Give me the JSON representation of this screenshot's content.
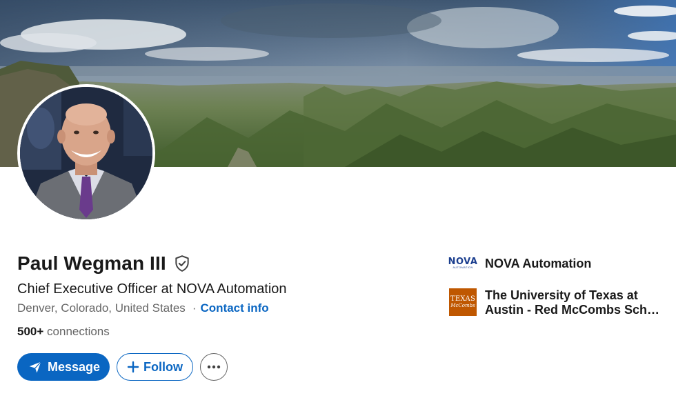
{
  "profile": {
    "name": "Paul Wegman III",
    "headline": "Chief Executive Officer at NOVA Automation",
    "location": "Denver, Colorado, United States",
    "separator": "·",
    "contact_info": "Contact info",
    "connections_count": "500+",
    "connections_label": "connections"
  },
  "actions": {
    "message_label": "Message",
    "follow_label": "Follow"
  },
  "aside": {
    "company": {
      "logo_text": "NOVA",
      "logo_subtext": "AUTOMATION",
      "name": "NOVA Automation"
    },
    "education": {
      "logo_text": "TEXAS",
      "logo_subtext": "McCombs",
      "name_line1": "The University of Texas at",
      "name_line2": "Austin - Red McCombs Schoo..."
    }
  },
  "icons": {
    "verified": "shield-check-icon",
    "message": "send-icon",
    "follow": "plus-icon",
    "more": "more-horizontal-icon"
  },
  "colors": {
    "primary": "#0a66c2",
    "text": "#191919",
    "muted": "#666666",
    "ut_orange": "#bf5700",
    "nova_blue": "#1c3f8f"
  }
}
